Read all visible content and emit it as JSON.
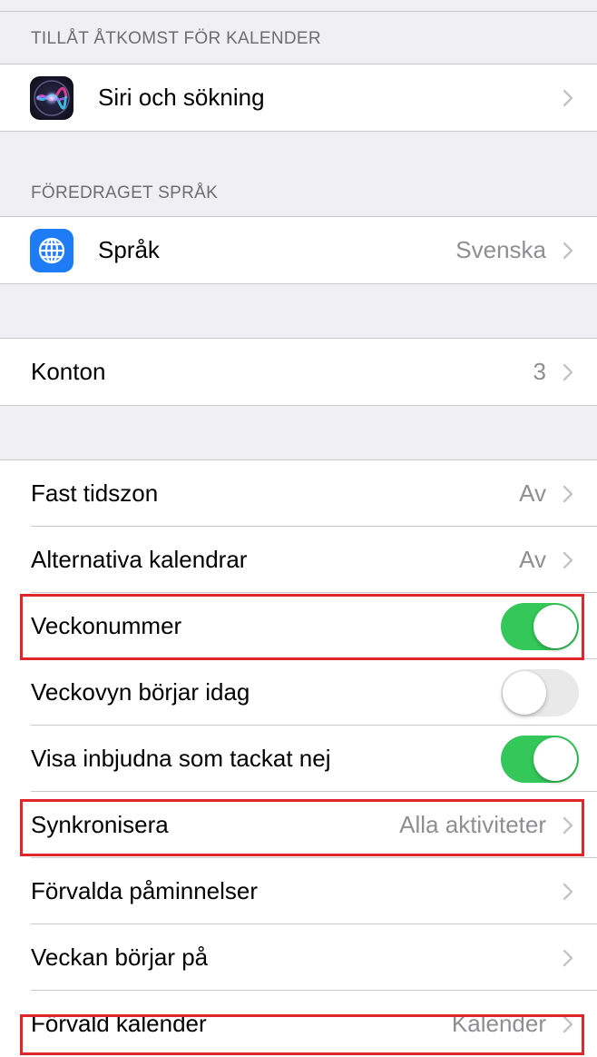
{
  "sections": {
    "calendar_access_header": "TILLÅT ÅTKOMST FÖR KALENDER",
    "preferred_language_header": "FÖREDRAGET SPRÅK"
  },
  "rows": {
    "siri": {
      "label": "Siri och sökning",
      "icon": "siri-icon"
    },
    "language": {
      "label": "Språk",
      "value": "Svenska",
      "icon": "globe-icon"
    },
    "accounts": {
      "label": "Konton",
      "value": "3"
    },
    "fixed_timezone": {
      "label": "Fast tidszon",
      "value": "Av"
    },
    "alt_calendars": {
      "label": "Alternativa kalendrar",
      "value": "Av"
    },
    "week_numbers": {
      "label": "Veckonummer",
      "toggle": true
    },
    "week_view_today": {
      "label": "Veckovyn börjar idag",
      "toggle": false
    },
    "show_declined": {
      "label": "Visa inbjudna som tackat nej",
      "toggle": true
    },
    "sync": {
      "label": "Synkronisera",
      "value": "Alla aktiviteter"
    },
    "default_reminders": {
      "label": "Förvalda påminnelser"
    },
    "week_starts": {
      "label": "Veckan börjar på"
    },
    "default_calendar": {
      "label": "Förvald kalender",
      "value": "Kalender"
    }
  },
  "colors": {
    "toggle_on": "#34c759",
    "highlight": "#e0262b",
    "language_icon_bg": "#1e7cf7"
  }
}
